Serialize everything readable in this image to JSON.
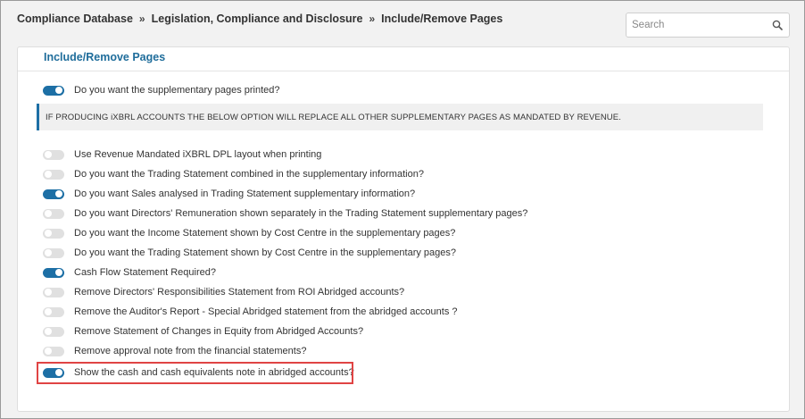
{
  "breadcrumb": {
    "items": [
      "Compliance Database",
      "Legislation, Compliance and Disclosure",
      "Include/Remove Pages"
    ],
    "separator": "»"
  },
  "search": {
    "placeholder": "Search",
    "value": "",
    "icon": "search-icon"
  },
  "panel": {
    "title": "Include/Remove Pages",
    "note": "IF PRODUCING iXBRL ACCOUNTS THE BELOW OPTION WILL REPLACE ALL OTHER SUPPLEMENTARY PAGES AS MANDATED BY REVENUE."
  },
  "options": [
    {
      "label": "Do you want the supplementary pages printed?",
      "on": true
    },
    {
      "label": "Use Revenue Mandated iXBRL DPL layout when printing",
      "on": false
    },
    {
      "label": "Do you want the Trading Statement combined in the supplementary information?",
      "on": false
    },
    {
      "label": "Do you want Sales analysed in Trading Statement supplementary information?",
      "on": true
    },
    {
      "label": "Do you want Directors' Remuneration shown separately in the Trading Statement supplementary pages?",
      "on": false
    },
    {
      "label": "Do you want the Income Statement shown by Cost Centre in the supplementary pages?",
      "on": false
    },
    {
      "label": "Do you want the Trading Statement shown by Cost Centre in the supplementary pages?",
      "on": false
    },
    {
      "label": "Cash Flow Statement Required?",
      "on": true
    },
    {
      "label": "Remove Directors' Responsibilities Statement from ROI Abridged accounts?",
      "on": false
    },
    {
      "label": "Remove the Auditor's Report - Special Abridged statement from the abridged accounts ?",
      "on": false
    },
    {
      "label": "Remove Statement of Changes in Equity from Abridged Accounts?",
      "on": false
    },
    {
      "label": "Remove approval note from the financial statements?",
      "on": false
    },
    {
      "label": "Show the cash and cash equivalents note in abridged accounts?",
      "on": true
    }
  ],
  "colors": {
    "accent": "#1d6fa5",
    "title": "#1f6d9b",
    "highlight": "#e04444",
    "toggle_off": "#e0e0e0"
  }
}
